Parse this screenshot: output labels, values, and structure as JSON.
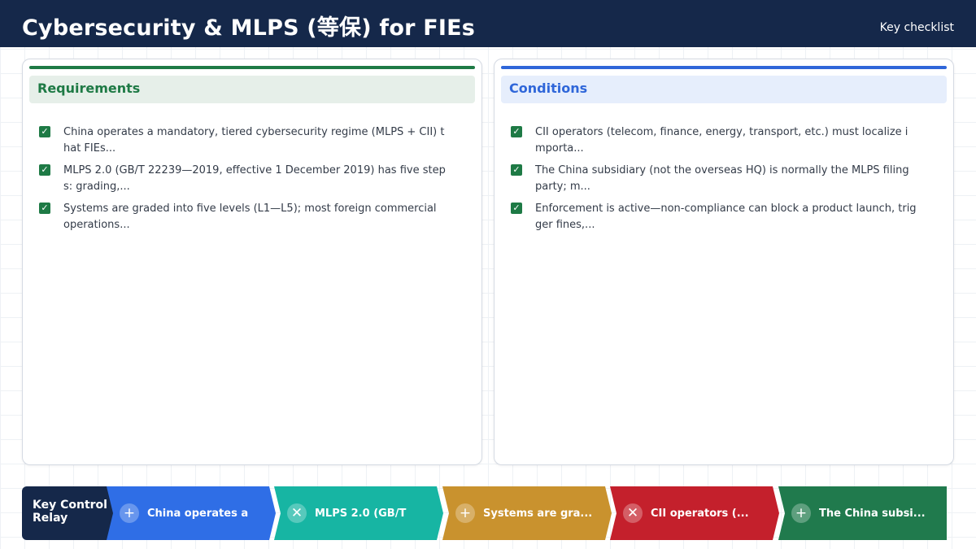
{
  "header": {
    "title": "Cybersecurity & MLPS (等保) for FIEs",
    "right_label": "Key checklist"
  },
  "colors": {
    "header_bg": "#15284a",
    "requirements_accent": "#1e7a45",
    "requirements_head_bg": "#e6efe9",
    "conditions_accent": "#2f66d9",
    "conditions_head_bg": "#e6eefc",
    "check": "#1e7a45"
  },
  "cards": [
    {
      "title": "Requirements",
      "items": [
        "China operates a mandatory, tiered cybersecurity regime (MLPS + CII) that FIEs...",
        "MLPS 2.0 (GB/T 22239—2019, effective 1 December 2019) has five steps: grading,...",
        "Systems are graded into five levels (L1—L5); most foreign commercial operations..."
      ]
    },
    {
      "title": "Conditions",
      "items": [
        "CII operators (telecom, finance, energy, transport, etc.) must localize importa...",
        "The China subsidiary (not the overseas HQ) is normally the MLPS filing party; m...",
        "Enforcement is active—non-compliance can block a product launch, trigger fines,..."
      ]
    }
  ],
  "relay": {
    "title": "Key Control Relay",
    "steps": [
      {
        "icon": "+",
        "icon_name": "plus-icon",
        "label": "China operates a",
        "color": "#2f6ee6"
      },
      {
        "icon": "✕",
        "icon_name": "close-icon",
        "label": "MLPS 2.0 (GB/T",
        "color": "#17b5a3"
      },
      {
        "icon": "+",
        "icon_name": "plus-icon",
        "label": "Systems are gra...",
        "color": "#c9922e"
      },
      {
        "icon": "✕",
        "icon_name": "close-icon",
        "label": "CII operators (...",
        "color": "#c4202c"
      },
      {
        "icon": "+",
        "icon_name": "plus-icon",
        "label": "The China subsi...",
        "color": "#207a4d"
      }
    ]
  }
}
